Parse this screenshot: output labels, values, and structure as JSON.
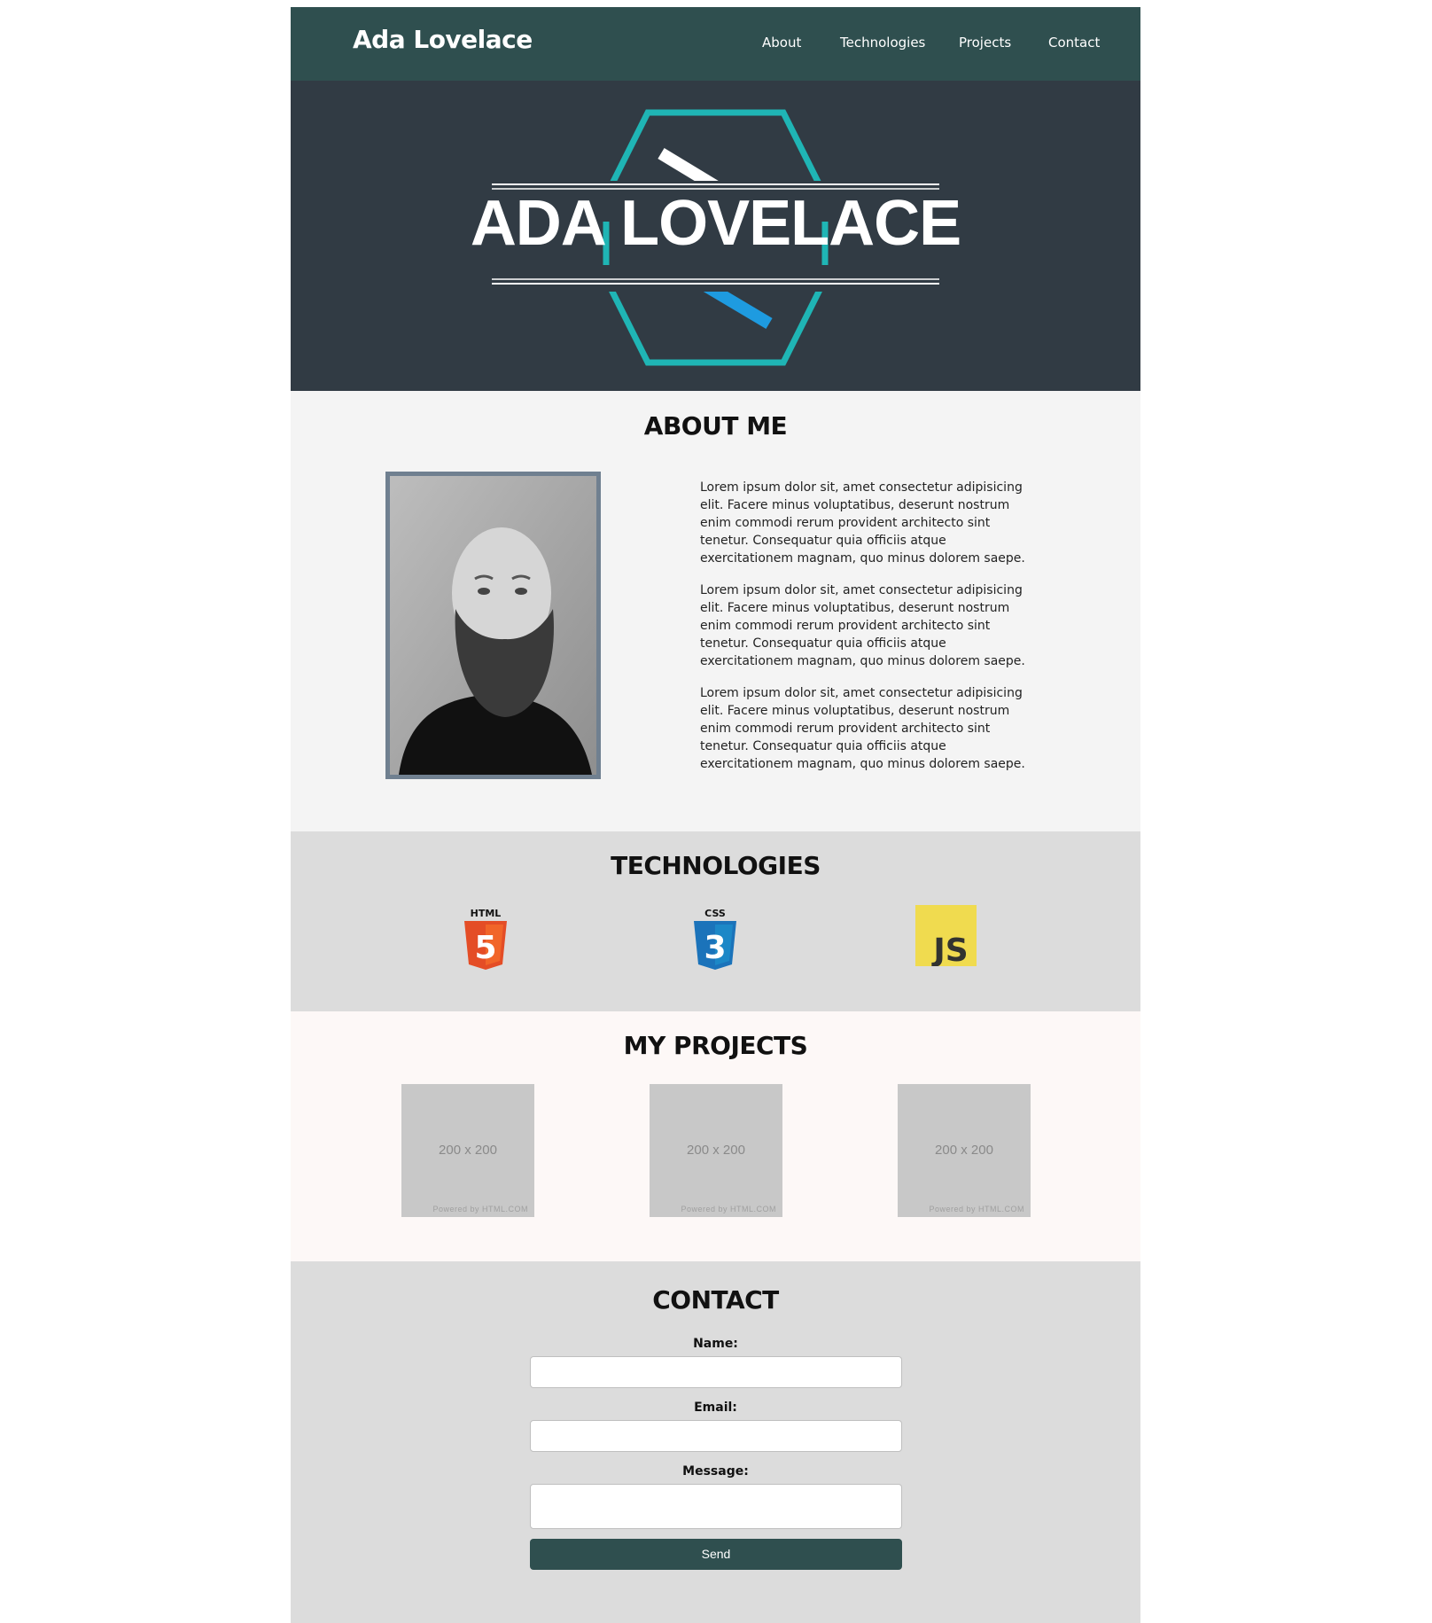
{
  "nav": {
    "brand": "Ada Lovelace",
    "links": [
      "About",
      "Technologies",
      "Projects",
      "Contact"
    ]
  },
  "hero": {
    "title": "ADA LOVELACE",
    "colors": {
      "hexagon": "#1fb5b5",
      "accent_blue": "#1e9be0",
      "background": "#313b44"
    }
  },
  "about": {
    "heading": "ABOUT ME",
    "photo_icon": "portrait-photo",
    "paragraphs": [
      "Lorem ipsum dolor sit, amet consectetur adipisicing elit. Facere minus voluptatibus, deserunt nostrum enim commodi rerum provident architecto sint tenetur. Consequatur quia officiis atque exercitationem magnam, quo minus dolorem saepe.",
      "Lorem ipsum dolor sit, amet consectetur adipisicing elit. Facere minus voluptatibus, deserunt nostrum enim commodi rerum provident architecto sint tenetur. Consequatur quia officiis atque exercitationem magnam, quo minus dolorem saepe.",
      "Lorem ipsum dolor sit, amet consectetur adipisicing elit. Facere minus voluptatibus, deserunt nostrum enim commodi rerum provident architecto sint tenetur. Consequatur quia officiis atque exercitationem magnam, quo minus dolorem saepe."
    ]
  },
  "technologies": {
    "heading": "TECHNOLOGIES",
    "items": [
      {
        "label": "HTML",
        "glyph": "5",
        "icon": "html5-icon",
        "color": "#e44d26"
      },
      {
        "label": "CSS",
        "glyph": "3",
        "icon": "css3-icon",
        "color": "#1b73ba"
      },
      {
        "label": "JS",
        "icon": "javascript-icon",
        "color": "#f0db4f"
      }
    ]
  },
  "projects": {
    "heading": "MY PROJECTS",
    "cards": [
      {
        "size_label": "200 x 200",
        "powered": "Powered by HTML.COM"
      },
      {
        "size_label": "200 x 200",
        "powered": "Powered by HTML.COM"
      },
      {
        "size_label": "200 x 200",
        "powered": "Powered by HTML.COM"
      }
    ]
  },
  "contact": {
    "heading": "CONTACT",
    "name_label": "Name:",
    "email_label": "Email:",
    "message_label": "Message:",
    "name_value": "",
    "email_value": "",
    "message_value": "",
    "send_label": "Send"
  }
}
